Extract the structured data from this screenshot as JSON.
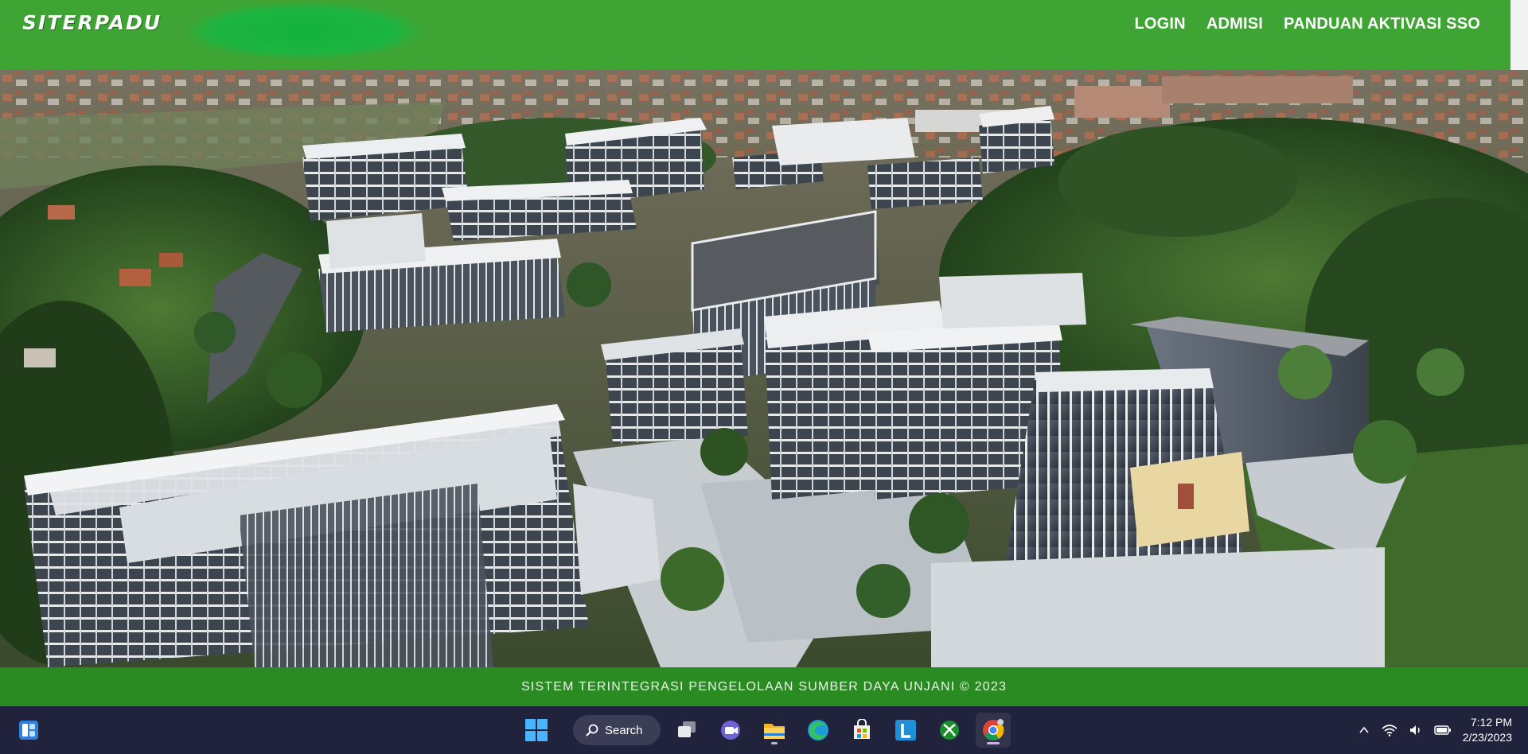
{
  "header": {
    "logo_text": "SITERPADU",
    "nav": [
      {
        "label": "LOGIN"
      },
      {
        "label": "ADMISI"
      },
      {
        "label": "PANDUAN AKTIVASI SSO"
      }
    ]
  },
  "hero": {
    "image_alt": "Aerial rendering of university campus buildings"
  },
  "footer": {
    "text": "SISTEM TERINTEGRASI PENGELOLAAN SUMBER DAYA UNJANI © 2023"
  },
  "taskbar": {
    "search_label": "Search",
    "apps": [
      {
        "icon": "task-view-icon"
      },
      {
        "icon": "chat-icon"
      },
      {
        "icon": "file-explorer-icon"
      },
      {
        "icon": "edge-icon"
      },
      {
        "icon": "store-icon"
      },
      {
        "icon": "l-app-icon"
      },
      {
        "icon": "xbox-icon"
      },
      {
        "icon": "chrome-icon"
      }
    ],
    "clock": {
      "time": "7:12 PM",
      "date": "2/23/2023"
    }
  },
  "colors": {
    "header_green": "#3ea535",
    "footer_green": "#2b8b23",
    "taskbar": "#20233b"
  }
}
